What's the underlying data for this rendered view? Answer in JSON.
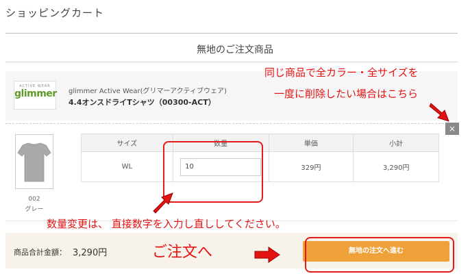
{
  "header": {
    "title": "ショッピングカート"
  },
  "section": {
    "title": "無地のご注文商品"
  },
  "product": {
    "logo_text": "glimmer",
    "logo_tagline": "ACTIVE WEAR",
    "brand_line": "glimmer Active Wear(グリマーアクティブウェア)",
    "name": "4.4オンスドライTシャツ（00300-ACT）",
    "color_code": "002",
    "color_name": "グレー",
    "shirt_color": "#a9a9a9"
  },
  "table": {
    "headers": [
      "サイズ",
      "数量",
      "単価",
      "小計"
    ],
    "rows": [
      {
        "size": "WL",
        "quantity": "10",
        "unit_price": "329円",
        "subtotal": "3,290円"
      }
    ]
  },
  "footer": {
    "total_label": "商品合計金額：",
    "total_value": "3,290円",
    "order_button": "無地の注文へ進む",
    "accent_color": "#f0a23a"
  },
  "close_button": "×",
  "annotations": {
    "delete_note_line1": "同じ商品で全カラー・全サイズを",
    "delete_note_line2": "一度に削除したい場合はこちら",
    "quantity_note": "数量変更は、 直接数字を入力し直ししてください。",
    "order_note": "ご注文へ",
    "color": "#e41313"
  }
}
